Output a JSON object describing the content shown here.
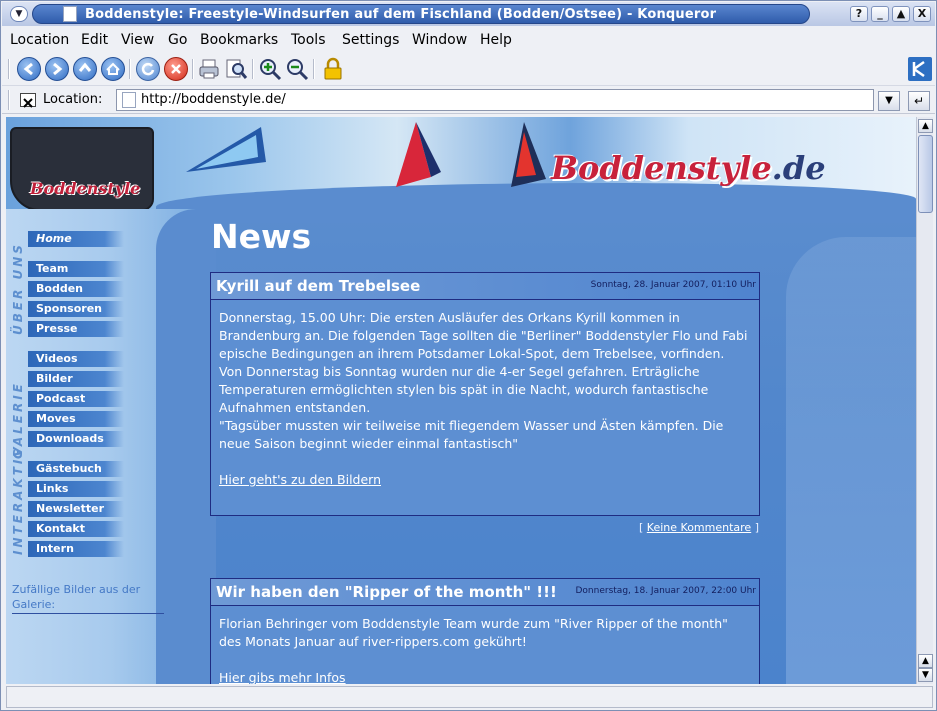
{
  "window": {
    "title": "Boddenstyle: Freestyle-Windsurfen auf dem Fischland (Bodden/Ostsee) - Konqueror",
    "buttons": [
      "?",
      "_",
      "▲",
      "X"
    ]
  },
  "menubar": {
    "items": [
      "Location",
      "Edit",
      "View",
      "Go",
      "Bookmarks",
      "Tools",
      "Settings",
      "Window",
      "Help"
    ]
  },
  "toolbar": {
    "icons": [
      "back-icon",
      "forward-icon",
      "up-icon",
      "home-icon",
      "reload-icon",
      "stop-icon",
      "print-icon",
      "find-icon",
      "zoom-in-icon",
      "zoom-out-icon",
      "security-lock-icon"
    ]
  },
  "locationbar": {
    "label": "Location:",
    "url": "http://boddenstyle.de/"
  },
  "page": {
    "brand": "Boddenstyle",
    "brand_tld": ".de",
    "logo_text": "Boddenstyle",
    "heading": "News",
    "nav": {
      "home": "Home",
      "ueber_uns_label": "ÜBER UNS",
      "ueber_uns": [
        "Team",
        "Bodden",
        "Sponsoren",
        "Presse"
      ],
      "galerie_label": "GALERIE",
      "galerie": [
        "Videos",
        "Bilder",
        "Podcast",
        "Moves",
        "Downloads"
      ],
      "interaktiv_label": "INTERAKTIV",
      "interaktiv": [
        "Gästebuch",
        "Links",
        "Newsletter",
        "Kontakt",
        "Intern"
      ]
    },
    "random_images_label": "Zufällige Bilder aus der Galerie:",
    "posts": [
      {
        "title": "Kyrill auf dem Trebelsee",
        "date": "Sonntag, 28. Januar 2007, 01:10 Uhr",
        "paragraphs": [
          "Donnerstag, 15.00 Uhr: Die ersten Ausläufer des Orkans Kyrill kommen in Brandenburg an. Die folgenden Tage sollten die \"Berliner\" Boddenstyler Flo und Fabi epische Bedingungen an ihrem Potsdamer Lokal-Spot, dem Trebelsee, vorfinden.",
          "Von Donnerstag bis Sonntag wurden nur die 4-er Segel gefahren. Erträgliche Temperaturen ermöglichten stylen bis spät in die Nacht, wodurch fantastische Aufnahmen entstanden.",
          "\"Tagsüber mussten wir teilweise mit fliegendem Wasser und Ästen kämpfen. Die neue Saison beginnt wieder einmal fantastisch\""
        ],
        "link": "Hier geht's zu den Bildern",
        "comments": "Keine Kommentare"
      },
      {
        "title": "Wir haben den \"Ripper of the month\" !!!",
        "date": "Donnerstag, 18. Januar 2007, 22:00 Uhr",
        "paragraphs": [
          "Florian Behringer vom Boddenstyle Team wurde zum \"River Ripper of the month\" des Monats Januar auf river-rippers.com gekührt!"
        ],
        "link": "Hier gibs mehr Infos"
      }
    ]
  },
  "colors": {
    "title_bar": "#2f5cab",
    "page_bg": "#5287cc",
    "post_border": "#1f2c82",
    "brand_red": "#c8213b",
    "nav_button": "#2d67b8"
  }
}
